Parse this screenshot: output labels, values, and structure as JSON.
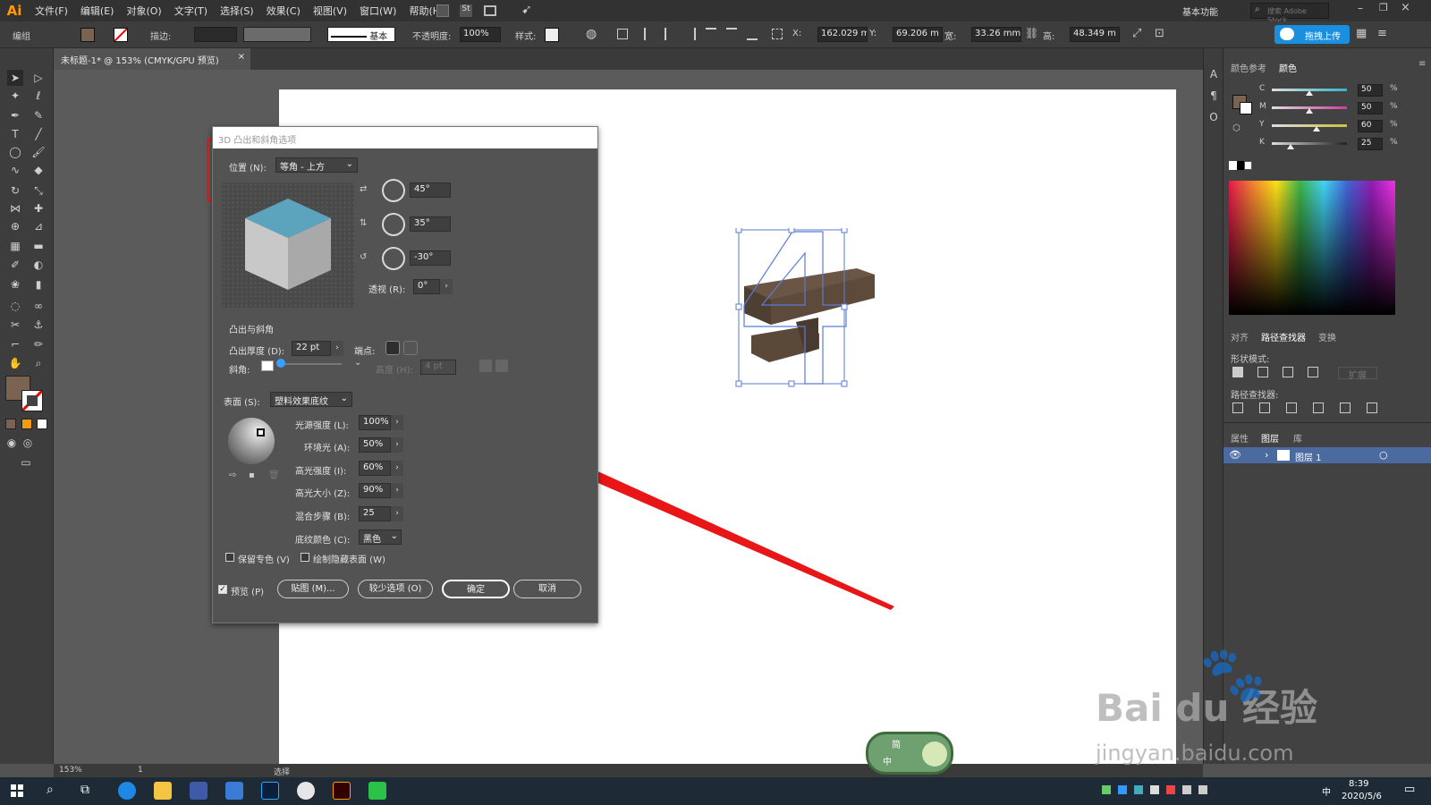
{
  "app": {
    "logo": "Ai"
  },
  "menu": [
    "文件(F)",
    "编辑(E)",
    "对象(O)",
    "文字(T)",
    "选择(S)",
    "效果(C)",
    "视图(V)",
    "窗口(W)",
    "帮助(H)"
  ],
  "workspace": "基本功能",
  "search_placeholder": "搜索 Adobe Stock",
  "upload_button": "拖拽上传",
  "control": {
    "mode": "编组",
    "stroke_label": "描边:",
    "stroke_style": "基本",
    "opacity_label": "不透明度:",
    "opacity": "100%",
    "style_label": "样式:",
    "x_label": "X:",
    "x": "162.029 m",
    "y_label": "Y:",
    "y": "69.206 m",
    "w_label": "宽:",
    "w": "33.26 mm",
    "h_label": "高:",
    "h": "48.349 m",
    "fill_color": "#7a6451"
  },
  "document": {
    "tab": "未标题-1* @ 153% (CMYK/GPU 预览)",
    "close": "×"
  },
  "dialog": {
    "title": "3D 凸出和斜角选项",
    "position_label": "位置 (N):",
    "position_value": "等角 - 上方",
    "rot_x": "45°",
    "rot_y": "35°",
    "rot_z": "-30°",
    "perspective_label": "透视 (R):",
    "perspective": "0°",
    "extrude_section": "凸出与斜角",
    "extrude_depth_label": "凸出厚度 (D):",
    "extrude_depth": "22 pt",
    "cap_label": "端点:",
    "bevel_label": "斜角:",
    "height_label": "高度 (H):",
    "height": "4 pt",
    "surface_label": "表面 (S):",
    "surface_value": "塑料效果底纹",
    "light_intensity_label": "光源强度 (L):",
    "light_intensity": "100%",
    "ambient_label": "环境光 (A):",
    "ambient": "50%",
    "highlight_intensity_label": "高光强度 (I):",
    "highlight_intensity": "60%",
    "highlight_size_label": "高光大小 (Z):",
    "highlight_size": "90%",
    "blend_steps_label": "混合步骤 (B):",
    "blend_steps": "25",
    "shading_color_label": "底纹颜色 (C):",
    "shading_color": "黑色",
    "preserve_spot": "保留专色 (V)",
    "draw_hidden": "绘制隐藏表面 (W)",
    "preview": "预览 (P)",
    "map_button": "贴图 (M)...",
    "fewer_options": "较少选项 (O)",
    "ok": "确定",
    "cancel": "取消"
  },
  "panels": {
    "color_guide": "颜色参考",
    "color": "颜色",
    "cmyk": [
      {
        "label": "C",
        "value": "50",
        "color": "#33b5c8"
      },
      {
        "label": "M",
        "value": "50",
        "color": "#c83fa0"
      },
      {
        "label": "Y",
        "value": "60",
        "color": "#c8c33f"
      },
      {
        "label": "K",
        "value": "25",
        "color": "#222222"
      }
    ],
    "pct": "%",
    "align": "对齐",
    "pathfinder": "路径查找器",
    "transform": "变换",
    "shape_modes": "形状模式:",
    "expand": "扩展",
    "pathfinders": "路径查找器:",
    "properties": "属性",
    "layers": "图层",
    "libraries": "库",
    "layer_name": "图层 1"
  },
  "status": {
    "zoom": "153%",
    "page": "1",
    "tool": "选择"
  },
  "taskbar": {
    "time": "8:39",
    "date": "2020/5/6",
    "ime": "中"
  },
  "watermark": {
    "brand": "Bai du 经验",
    "url": "jingyan.baidu.com"
  },
  "floating_badge": {
    "top": "简",
    "left": "中"
  }
}
